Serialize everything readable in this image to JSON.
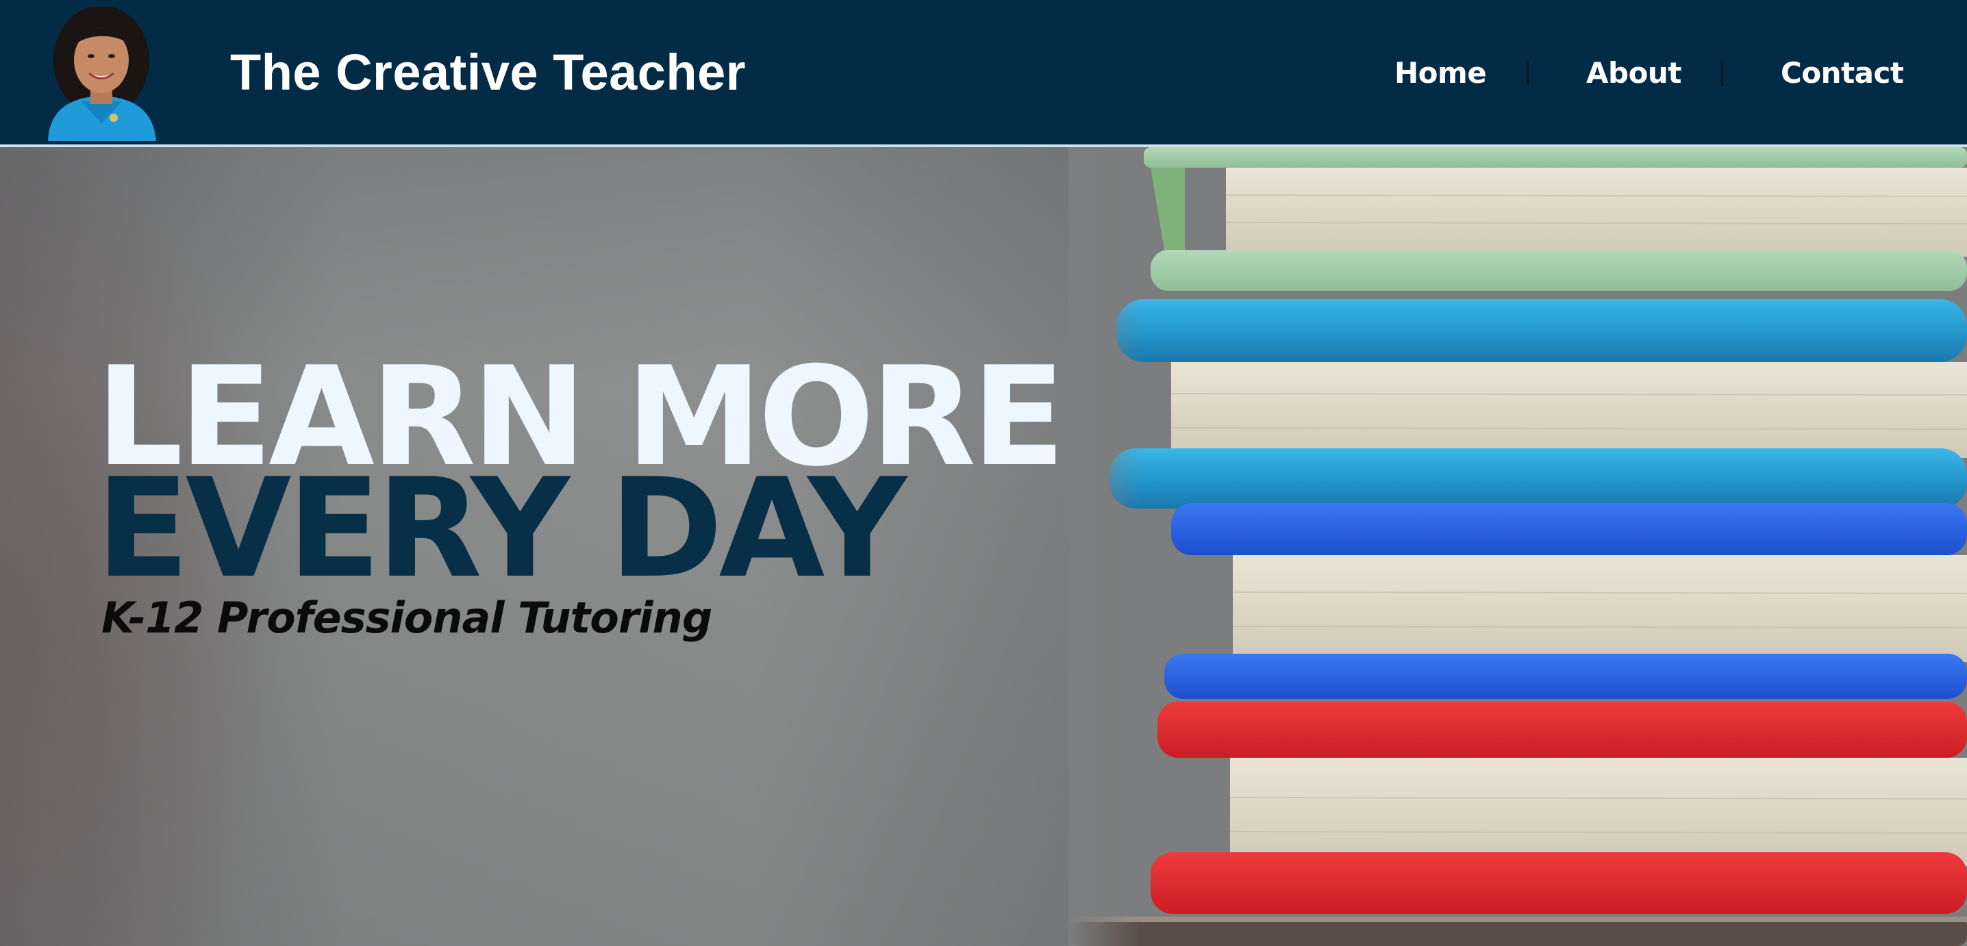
{
  "header": {
    "site_title": "The Creative Teacher",
    "avatar_icon": "teacher-portrait",
    "nav": [
      {
        "label": "Home"
      },
      {
        "label": "About"
      },
      {
        "label": "Contact"
      }
    ]
  },
  "hero": {
    "headline_line1": "LEARN MORE",
    "headline_line2": "EVERY DAY",
    "tagline": "K-12 Professional Tutoring",
    "image_subject": "stack-of-books-photo"
  },
  "colors": {
    "header_bg": "#032b45",
    "headline_light": "#eef6ff",
    "headline_dark": "#082f48",
    "tagline": "#0b0b0b",
    "book_blue": "#2a9fd0",
    "book_red": "#e02a2e",
    "book_green": "#9cc7a6"
  }
}
